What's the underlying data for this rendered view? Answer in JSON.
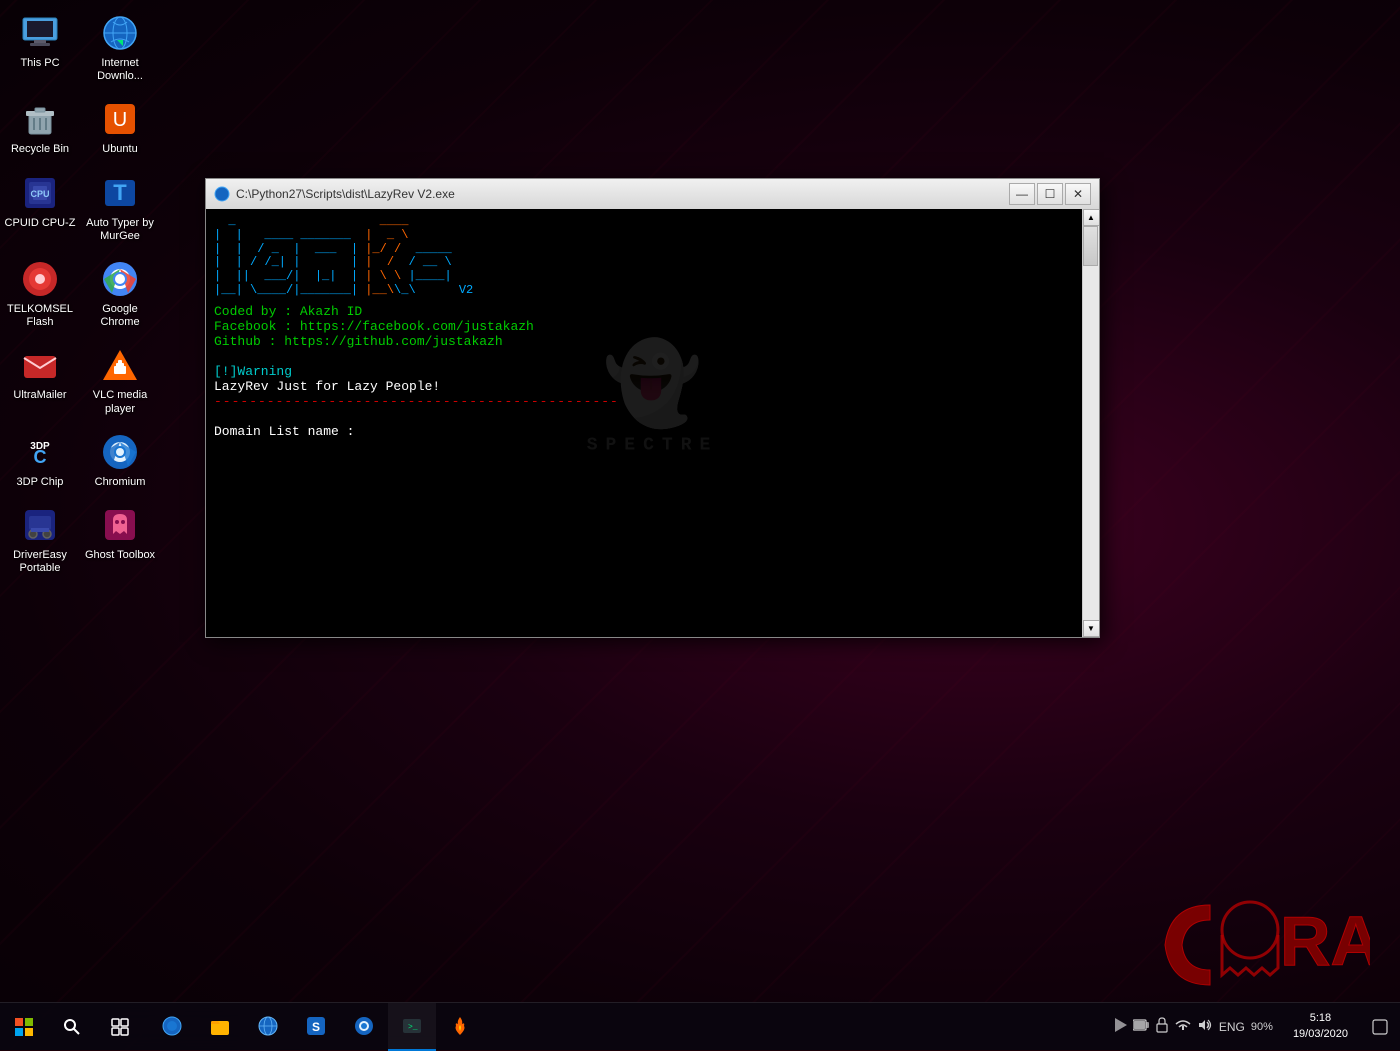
{
  "desktop": {
    "background_color": "#1a0008"
  },
  "icons": [
    {
      "id": "this-pc",
      "label": "This PC",
      "icon": "💻",
      "col": 0,
      "row": 0
    },
    {
      "id": "internet-download",
      "label": "Internet Downlo...",
      "icon": "🌐",
      "col": 1,
      "row": 0
    },
    {
      "id": "recycle-bin",
      "label": "Recycle Bin",
      "icon": "♻",
      "col": 0,
      "row": 1
    },
    {
      "id": "ubuntu",
      "label": "Ubuntu",
      "icon": "📦",
      "col": 1,
      "row": 1
    },
    {
      "id": "cpuid",
      "label": "CPUID CPU-Z",
      "icon": "🔲",
      "col": 0,
      "row": 2
    },
    {
      "id": "auto-typer",
      "label": "Auto Typer by MurGee",
      "icon": "T",
      "col": 1,
      "row": 2
    },
    {
      "id": "telkomsel",
      "label": "TELKOMSEL Flash",
      "icon": "📱",
      "col": 0,
      "row": 3
    },
    {
      "id": "google-chrome",
      "label": "Google Chrome",
      "icon": "🔵",
      "col": 1,
      "row": 3
    },
    {
      "id": "ultramailer",
      "label": "UltraMailer",
      "icon": "✉",
      "col": 0,
      "row": 4
    },
    {
      "id": "vlc",
      "label": "VLC media player",
      "icon": "🔶",
      "col": 0,
      "row": 5
    },
    {
      "id": "3dp-chip",
      "label": "3DP Chip",
      "icon": "C",
      "col": 0,
      "row": 6
    },
    {
      "id": "chromium",
      "label": "Chromium",
      "icon": "🔵",
      "col": 0,
      "row": 7
    },
    {
      "id": "driver-easy",
      "label": "DriverEasy Portable",
      "icon": "🔧",
      "col": 0,
      "row": 8
    },
    {
      "id": "ghost-toolbox",
      "label": "Ghost Toolbox",
      "icon": "👻",
      "col": 0,
      "row": 9
    }
  ],
  "terminal": {
    "title": "C:\\Python27\\Scripts\\dist\\LazyRev V2.exe",
    "icon": "⚙",
    "ascii_art": [
      " _                    ____",
      "|  |   ____ _______  |  _ \\",
      "|  |  / _  |  ___  | |_/ /  _____",
      "|  | / /_| |       | |  /  / __ \\",
      "|  ||  ___/|  |_|  | | \\ \\ |____|",
      "|__| \\____/|_______| |__\\_\\      V2"
    ],
    "info_lines": [
      "Coded by : Akazh ID",
      "Facebook : https://facebook.com/justakazh",
      "Github   : https://github.com/justakazh"
    ],
    "warning": "[!]Warning",
    "warning_msg": "LazyRev Just for Lazy People!",
    "dashed": "----------------------------------------------",
    "prompt": "Domain List name :"
  },
  "taskbar": {
    "start_label": "⊞",
    "search_label": "🔍",
    "time": "5:18",
    "date": "19/03/2020",
    "apps": [
      {
        "id": "file-explorer",
        "icon": "📁",
        "active": false
      },
      {
        "id": "search",
        "icon": "🔍",
        "active": false
      },
      {
        "id": "network",
        "icon": "🌐",
        "active": false
      },
      {
        "id": "folder",
        "icon": "📂",
        "active": false
      },
      {
        "id": "blue-app",
        "icon": "🔵",
        "active": false
      },
      {
        "id": "settings",
        "icon": "⚙",
        "active": true
      },
      {
        "id": "terminal-app",
        "icon": "▶",
        "active": true
      },
      {
        "id": "fire-app",
        "icon": "🔥",
        "active": false
      }
    ],
    "tray_icons": [
      "💾",
      "🔒",
      "📶",
      "🔊",
      "⌨"
    ],
    "battery_pct": "90"
  },
  "crax": {
    "brand": "CRAX"
  }
}
